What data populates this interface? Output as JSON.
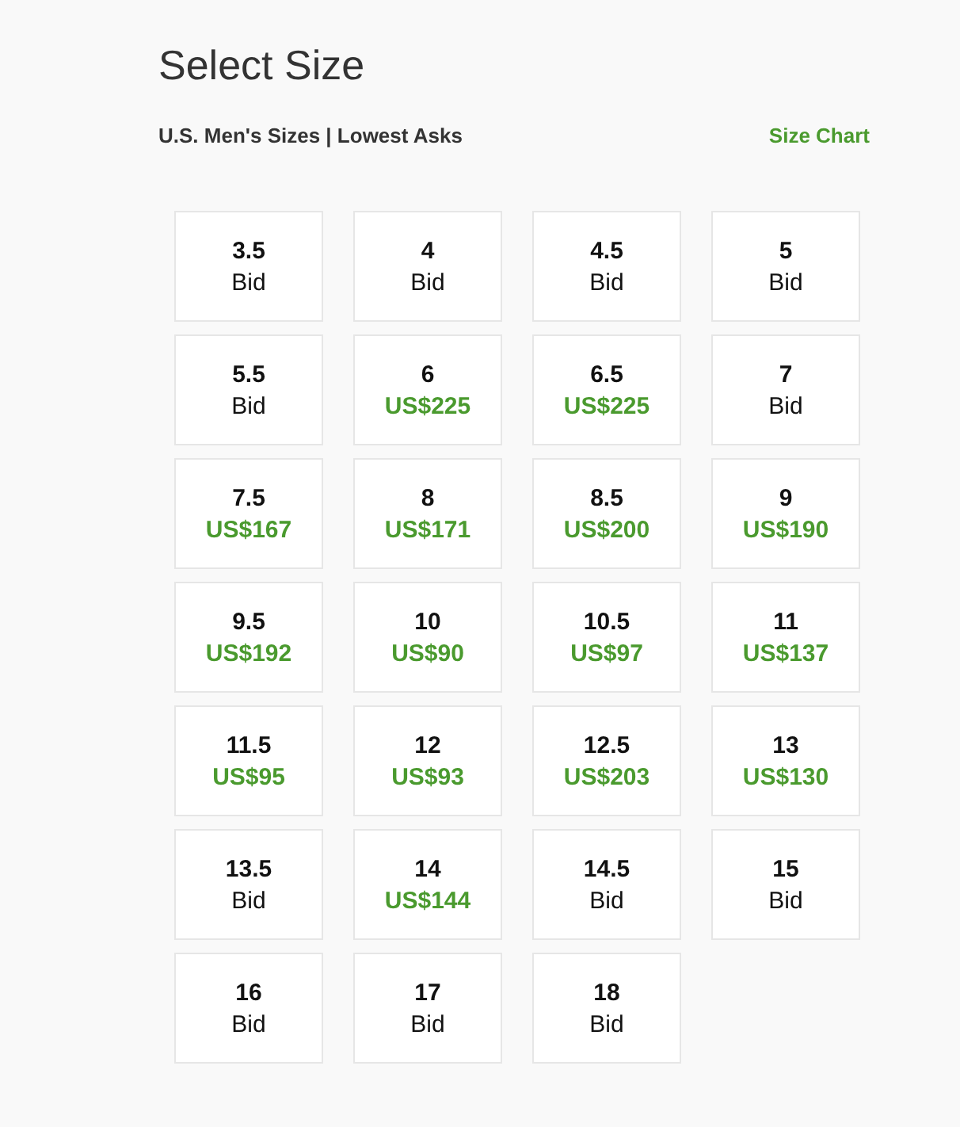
{
  "title": "Select Size",
  "subtitle": "U.S. Men's Sizes | Lowest Asks",
  "size_chart_link": "Size Chart",
  "sizes": [
    {
      "size": "3.5",
      "price": "Bid",
      "kind": "bid"
    },
    {
      "size": "4",
      "price": "Bid",
      "kind": "bid"
    },
    {
      "size": "4.5",
      "price": "Bid",
      "kind": "bid"
    },
    {
      "size": "5",
      "price": "Bid",
      "kind": "bid"
    },
    {
      "size": "5.5",
      "price": "Bid",
      "kind": "bid"
    },
    {
      "size": "6",
      "price": "US$225",
      "kind": "ask"
    },
    {
      "size": "6.5",
      "price": "US$225",
      "kind": "ask"
    },
    {
      "size": "7",
      "price": "Bid",
      "kind": "bid"
    },
    {
      "size": "7.5",
      "price": "US$167",
      "kind": "ask"
    },
    {
      "size": "8",
      "price": "US$171",
      "kind": "ask"
    },
    {
      "size": "8.5",
      "price": "US$200",
      "kind": "ask"
    },
    {
      "size": "9",
      "price": "US$190",
      "kind": "ask"
    },
    {
      "size": "9.5",
      "price": "US$192",
      "kind": "ask"
    },
    {
      "size": "10",
      "price": "US$90",
      "kind": "ask"
    },
    {
      "size": "10.5",
      "price": "US$97",
      "kind": "ask"
    },
    {
      "size": "11",
      "price": "US$137",
      "kind": "ask"
    },
    {
      "size": "11.5",
      "price": "US$95",
      "kind": "ask"
    },
    {
      "size": "12",
      "price": "US$93",
      "kind": "ask"
    },
    {
      "size": "12.5",
      "price": "US$203",
      "kind": "ask"
    },
    {
      "size": "13",
      "price": "US$130",
      "kind": "ask"
    },
    {
      "size": "13.5",
      "price": "Bid",
      "kind": "bid"
    },
    {
      "size": "14",
      "price": "US$144",
      "kind": "ask"
    },
    {
      "size": "14.5",
      "price": "Bid",
      "kind": "bid"
    },
    {
      "size": "15",
      "price": "Bid",
      "kind": "bid"
    },
    {
      "size": "16",
      "price": "Bid",
      "kind": "bid"
    },
    {
      "size": "17",
      "price": "Bid",
      "kind": "bid"
    },
    {
      "size": "18",
      "price": "Bid",
      "kind": "bid"
    }
  ]
}
